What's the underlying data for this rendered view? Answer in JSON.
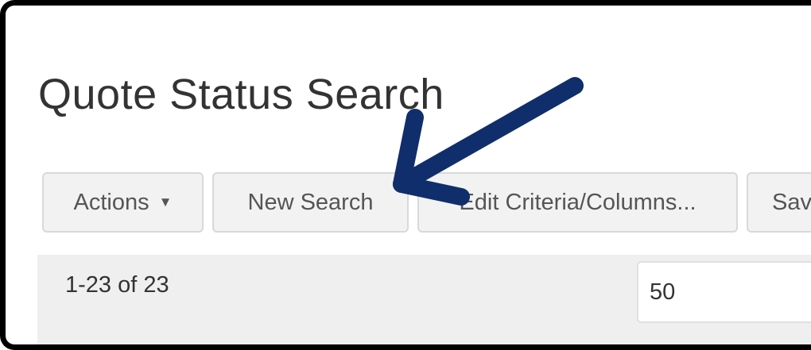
{
  "page": {
    "title": "Quote Status Search"
  },
  "toolbar": {
    "actions_label": "Actions",
    "actions_caret": "▼",
    "new_search_label": "New Search",
    "edit_criteria_label": "Edit Criteria/Columns...",
    "save_label": "Sav"
  },
  "results": {
    "count_text": "1-23 of 23",
    "page_size_value": "50"
  },
  "annotation": {
    "arrow_color": "#102e6b",
    "arrow_icon": "arrow-pointer-icon"
  }
}
